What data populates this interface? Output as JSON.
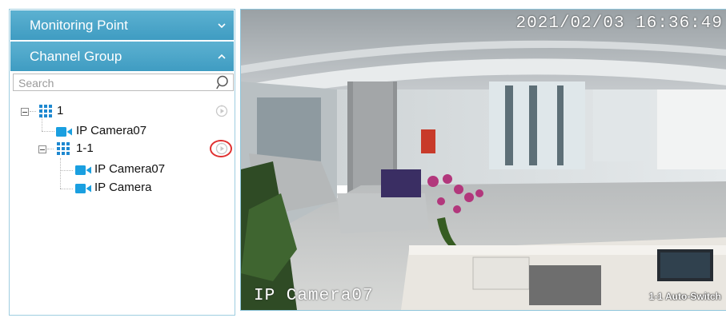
{
  "sidebar": {
    "accordion": [
      {
        "label": "Monitoring Point",
        "state": "collapsed"
      },
      {
        "label": "Channel Group",
        "state": "expanded"
      }
    ],
    "search": {
      "placeholder": "Search",
      "value": ""
    },
    "tree": {
      "root": {
        "label": "1"
      },
      "root_camera": {
        "label": "IP Camera07"
      },
      "subgroup": {
        "label": "1-1"
      },
      "sub_cameras": [
        {
          "label": "IP Camera07"
        },
        {
          "label": "IP Camera"
        }
      ]
    }
  },
  "video": {
    "timestamp": "2021/02/03 16:36:49",
    "camera_name": "IP Camera07",
    "status": "1-1 Auto-Switch"
  },
  "colors": {
    "accordion_header": "#4aa6c9",
    "panel_border": "#9ecde0",
    "camera_icon": "#1a9fe0",
    "group_icon": "#1e88d0",
    "highlight_ring": "#e03030"
  },
  "icons": {
    "accordion_collapsed": "chevron-down-icon",
    "accordion_expanded": "chevron-up-icon",
    "search": "search-icon",
    "group": "group-grid-icon",
    "camera": "camera-icon",
    "play": "play-circle-icon"
  }
}
